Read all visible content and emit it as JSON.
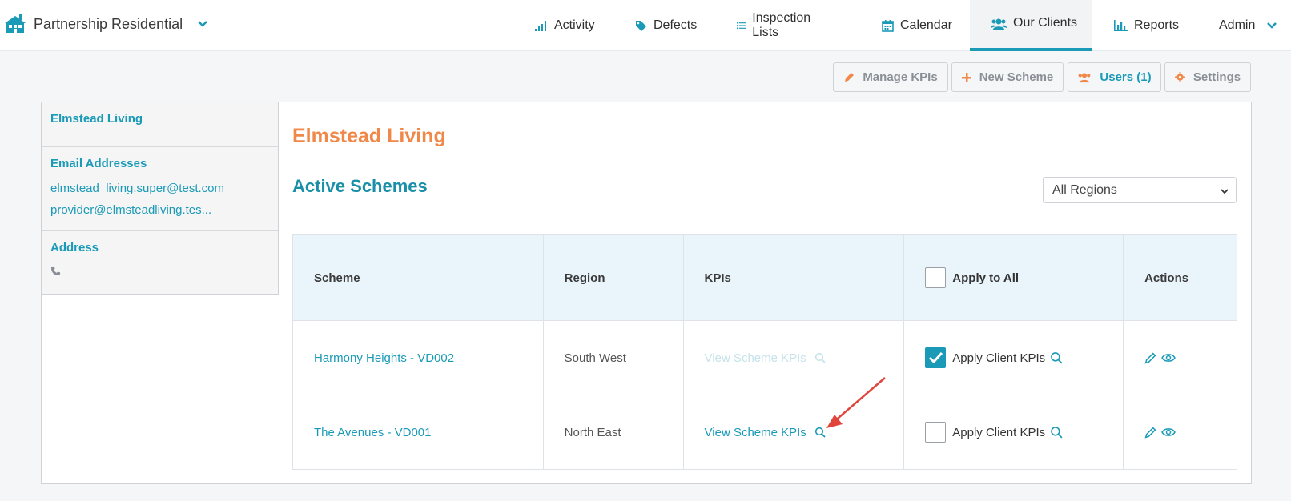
{
  "brand": {
    "name": "Partnership Residential"
  },
  "nav": [
    {
      "label": "Activity",
      "icon": "signal-icon"
    },
    {
      "label": "Defects",
      "icon": "tag-icon"
    },
    {
      "label": "Inspection Lists",
      "icon": "list-icon"
    },
    {
      "label": "Calendar",
      "icon": "calendar-icon"
    },
    {
      "label": "Our Clients",
      "icon": "users-icon",
      "active": true
    },
    {
      "label": "Reports",
      "icon": "bar-chart-icon"
    },
    {
      "label": "Admin",
      "icon": "chevron-down-icon"
    }
  ],
  "toolbar": {
    "manage_kpis": "Manage KPIs",
    "new_scheme": "New Scheme",
    "users": "Users (1)",
    "settings": "Settings"
  },
  "sidebar": {
    "client_name": "Elmstead Living",
    "email_header": "Email Addresses",
    "emails": [
      "elmstead_living.super@test.com",
      "provider@elmsteadliving.tes..."
    ],
    "address_header": "Address",
    "phone_icon": "phone-icon"
  },
  "main": {
    "title": "Elmstead Living",
    "subtitle": "Active Schemes",
    "region_filter": "All Regions"
  },
  "table": {
    "headers": {
      "scheme": "Scheme",
      "region": "Region",
      "kpis": "KPIs",
      "apply_all": "Apply to All",
      "actions": "Actions"
    },
    "rows": [
      {
        "scheme": "Harmony Heights - VD002",
        "region": "South West",
        "kpi_link": "View Scheme KPIs",
        "kpi_disabled": true,
        "apply_label": "Apply Client KPIs",
        "checked": true
      },
      {
        "scheme": "The Avenues - VD001",
        "region": "North East",
        "kpi_link": "View Scheme KPIs",
        "kpi_disabled": false,
        "apply_label": "Apply Client KPIs",
        "checked": false
      }
    ]
  },
  "colors": {
    "accent": "#1a9ab7",
    "title": "#f0884a",
    "annotation": "#e0443a"
  }
}
